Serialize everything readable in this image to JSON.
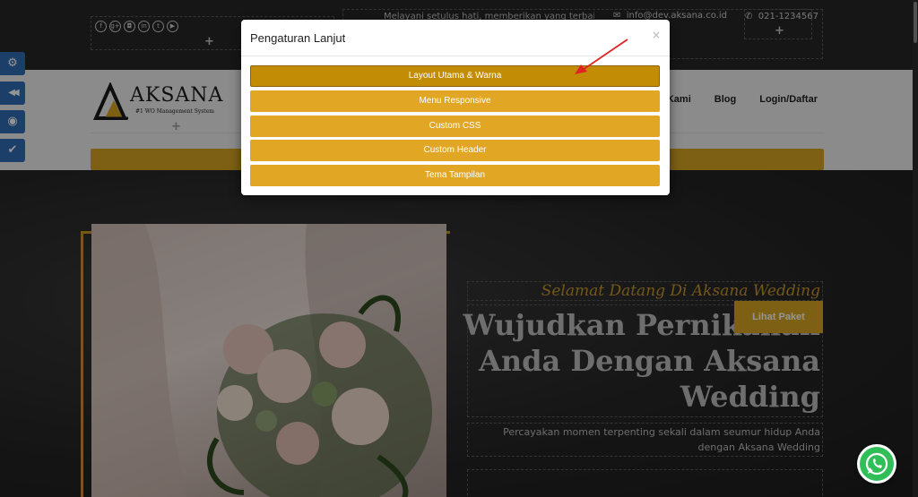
{
  "topbar": {
    "social_icons": [
      {
        "name": "facebook-icon",
        "glyph": "f"
      },
      {
        "name": "google-plus-icon",
        "glyph": "g+"
      },
      {
        "name": "instagram-icon",
        "glyph": "◘"
      },
      {
        "name": "linkedin-icon",
        "glyph": "in"
      },
      {
        "name": "twitter-icon",
        "glyph": "t"
      },
      {
        "name": "youtube-icon",
        "glyph": "▶"
      }
    ],
    "tagline": "Melayani setulus hati, memberikan yang terbaik",
    "email": "info@dev.aksana.co.id",
    "phone": "021-1234567",
    "add_symbol": "+"
  },
  "header": {
    "logo_text": "AKSANA",
    "logo_sub": "#1 WO Management System",
    "nav": [
      "Kami",
      "Blog",
      "Login/Daftar"
    ]
  },
  "hero": {
    "welcome": "Selamat Datang Di Aksana Wedding",
    "headline_lines": [
      "Wujudkan Pernikahan",
      "Anda Dengan Aksana",
      "Wedding"
    ],
    "desc_lines": [
      "Percayakan momen terpenting sekali dalam seumur hidup Anda",
      "dengan Aksana Wedding"
    ],
    "cta_label": "Lihat Paket"
  },
  "modal": {
    "title": "Pengaturan Lanjut",
    "close_symbol": "×",
    "buttons": [
      "Layout Utama & Warna",
      "Menu Responsive",
      "Custom CSS",
      "Custom Header",
      "Tema Tampilan"
    ],
    "active_index": 0
  },
  "sidebar_tools": [
    {
      "name": "settings-gears-icon",
      "glyph": "⚙"
    },
    {
      "name": "rewind-icon",
      "glyph": "◀◀"
    },
    {
      "name": "eye-icon",
      "glyph": "◉"
    },
    {
      "name": "check-icon",
      "glyph": "✔"
    }
  ],
  "colors": {
    "gold": "#d8a524",
    "gold_active": "#c38c05",
    "tool_blue": "#2f6db3",
    "whatsapp": "#2fbe57",
    "annotation_arrow": "#e02424"
  }
}
